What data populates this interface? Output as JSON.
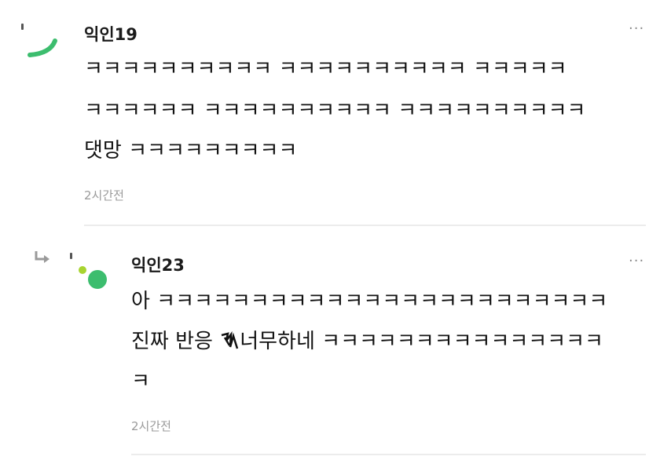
{
  "comments": [
    {
      "author": "익인19",
      "lines": [
        "ㅋㅋㅋㅋㅋㅋㅋㅋㅋㅋ ㅋㅋㅋㅋㅋㅋㅋㅋㅋㅋ ㅋㅋㅋㅋㅋ",
        "ㅋㅋㅋㅋㅋㅋ ㅋㅋㅋㅋㅋㅋㅋㅋㅋㅋ ㅋㅋㅋㅋㅋㅋㅋㅋㅋㅋ",
        "댓망 ㅋㅋㅋㅋㅋㅋㅋㅋㅋ"
      ],
      "time": "2시간전",
      "more": "···",
      "avatar_icon": "green-arc-avatar-icon"
    },
    {
      "author": "익인23",
      "lines": [
        "아 ㅋㅋㅋㅋㅋㅋㅋㅋㅋㅋㅋㅋㅋㅋㅋㅋㅋㅋㅋㅋㅋㅋㅋㅋ",
        "ㅋ"
      ],
      "line2_before": "진짜 반응 ",
      "line2_after": "너무하네 ㅋㅋㅋㅋㅋㅋㅋㅋㅋㅋㅋㅋㅋㅋㅋ",
      "time": "2시간전",
      "more": "···",
      "reply_icon": "reply-arrow-icon",
      "avatar_icon": "green-dots-avatar-icon"
    }
  ],
  "colors": {
    "accent_green": "#3cbd6e",
    "light_green": "#a8d430",
    "time_gray": "#9a9a9a",
    "divider": "#ececec"
  }
}
